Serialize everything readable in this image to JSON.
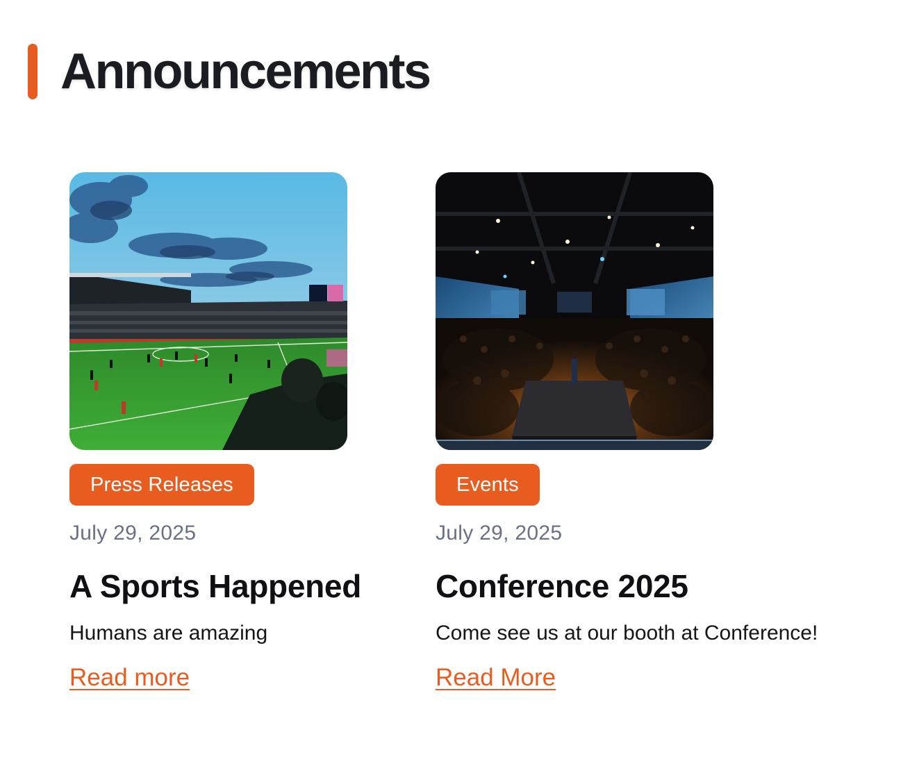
{
  "section": {
    "title": "Announcements",
    "accent_color": "#e85d1f"
  },
  "cards": [
    {
      "image_icon": "stadium-photo",
      "tag": "Press Releases",
      "date": "July 29, 2025",
      "title": "A Sports Happened",
      "description": "Humans are amazing",
      "link_label": "Read more"
    },
    {
      "image_icon": "conference-photo",
      "tag": "Events",
      "date": "July 29, 2025",
      "title": "Conference 2025",
      "description": "Come see us at our booth at Conference!",
      "link_label": "Read More"
    }
  ],
  "colors": {
    "accent": "#e85d1f",
    "date_text": "#6a7088",
    "heading_text": "#1b1b22"
  }
}
